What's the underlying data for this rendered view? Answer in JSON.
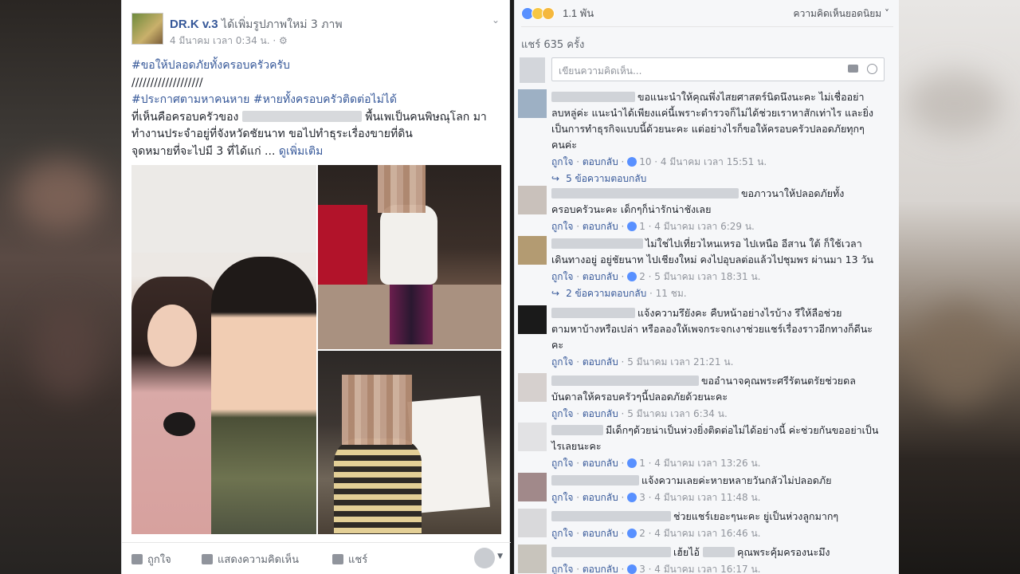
{
  "post": {
    "author": "DR.K v.3",
    "action": "ได้เพิ่มรูปภาพใหม่ 3 ภาพ",
    "timestamp": "4 มีนาคม เวลา 0:34 น.",
    "audience_icon": "gear-icon",
    "tag1": "#ขอให้ปลอดภัยทั้งครอบครัวครับ",
    "slashes": "///////////////////",
    "tag2": "#ประกาศตามหาคนหาย",
    "tag3": "#หายทั้งครอบครัวติดต่อไม่ได้",
    "body_1": "ที่เห็นคือครอบครัวของ",
    "body_2": "พื้นเพเป็นคนพิษณุโลก มา",
    "body_3": "ทำงานประจำอยู่ที่จังหวัดชัยนาท ขอไปทำธุระเรื่องขายที่ดิน",
    "body_4": "จุดหมายที่จะไปมี 3 ที่ได้แก่ ...",
    "see_more": "ดูเพิ่มเติม",
    "actions": {
      "like": "ถูกใจ",
      "comment": "แสดงความคิดเห็น",
      "share": "แชร์"
    }
  },
  "panel": {
    "reaction_count": "1.1 พัน",
    "sort_label": "ความคิดเห็นยอดนิยม",
    "shares": "แชร์ 635 ครั้ง",
    "comment_placeholder": "เขียนความคิดเห็น...",
    "like": "ถูกใจ",
    "reply": "ตอบกลับ",
    "colors": {
      "link": "#365899",
      "meta": "#90949c",
      "like_badge": "#5890ff"
    }
  },
  "comments": [
    {
      "line1": "ขอแนะนำให้คุณพึ่งไสยศาสตร์นิดนึงนะคะ ไม่เชื่ออย่า",
      "line2": "ลบหลู่ค่ะ แนะนำได้เพียงแค่นี้เพราะตำรวจก็ไม่ได้ช่วยเราหาสักเท่าไร และยิ่ง",
      "line3": "เป็นการทำธุรกิจแบบนี้ด้วยนะคะ แต่อย่างไรก็ขอให้ครอบครัวปลอดภัยทุกๆ",
      "line4": "คนค่ะ",
      "likes": "10",
      "time": "4 มีนาคม เวลา 15:51 น.",
      "replies": "5 ข้อความตอบกลับ"
    },
    {
      "line1": "ขอภาวนาให้ปลอดภัยทั้ง",
      "line2": "ครอบครัวนะคะ เด็กๆก็น่ารักน่าชังเลย",
      "likes": "1",
      "time": "4 มีนาคม เวลา 6:29 น."
    },
    {
      "line1": "ไม่ใช่ไปเที่ยวไหนเหรอ ไปเหนือ อีสาน ใต้ ก็ใช้เวลา",
      "line2": "เดินทางอยู่ อยู่ชัยนาท ไปเชียงใหม่ คงไปอุบลต่อแล้วไปชุมพร ผ่านมา 13 วัน",
      "likes": "2",
      "time": "5 มีนาคม เวลา 18:31 น.",
      "replies": "2 ข้อความตอบกลับ",
      "reply_time": "11 ชม."
    },
    {
      "line1": "แจ้งความรึยังคะ คืบหน้าอย่างไรบ้าง รึให้ลือช่วย",
      "line2": "ตามหาบ้างหรือเปล่า หรือลองให้เพจกระจกเงาช่วยแชร์เรื่องราวอีกทางก็ดีนะ",
      "line3": "คะ",
      "time": "5 มีนาคม เวลา 21:21 น."
    },
    {
      "line1": "ขออำนาจคุณพระศรีรัตนตรัยช่วยดล",
      "line2": "บันดาลให้ครอบครัวๆนี้ปลอดภัยด้วยนะคะ",
      "time": "5 มีนาคม เวลา 6:34 น."
    },
    {
      "line1": "มีเด็กๆด้วยน่าเป็นห่วงยิ่งติดต่อไม่ได้อย่างนี้ ค่ะช่วยกันขออย่าเป็น",
      "line2": "ไรเลยนะคะ",
      "likes": "1",
      "time": "4 มีนาคม เวลา 13:26 น."
    },
    {
      "line1": "แจ้งความเลยค่ะหายหลายวันกลัวไม่ปลอดภัย",
      "likes": "3",
      "time": "4 มีนาคม เวลา 11:48 น."
    },
    {
      "line1": "ช่วยแชร์เยอะๆนะคะ ยู่เป็นห่วงลูกมากๆ",
      "likes": "2",
      "time": "4 มีนาคม เวลา 16:46 น."
    },
    {
      "line1": "เฮ้ยไอ้",
      "line1b": "คุณพระคุ้มครองนะมึง",
      "likes": "3",
      "time": "4 มีนาคม เวลา 16:17 น."
    }
  ]
}
